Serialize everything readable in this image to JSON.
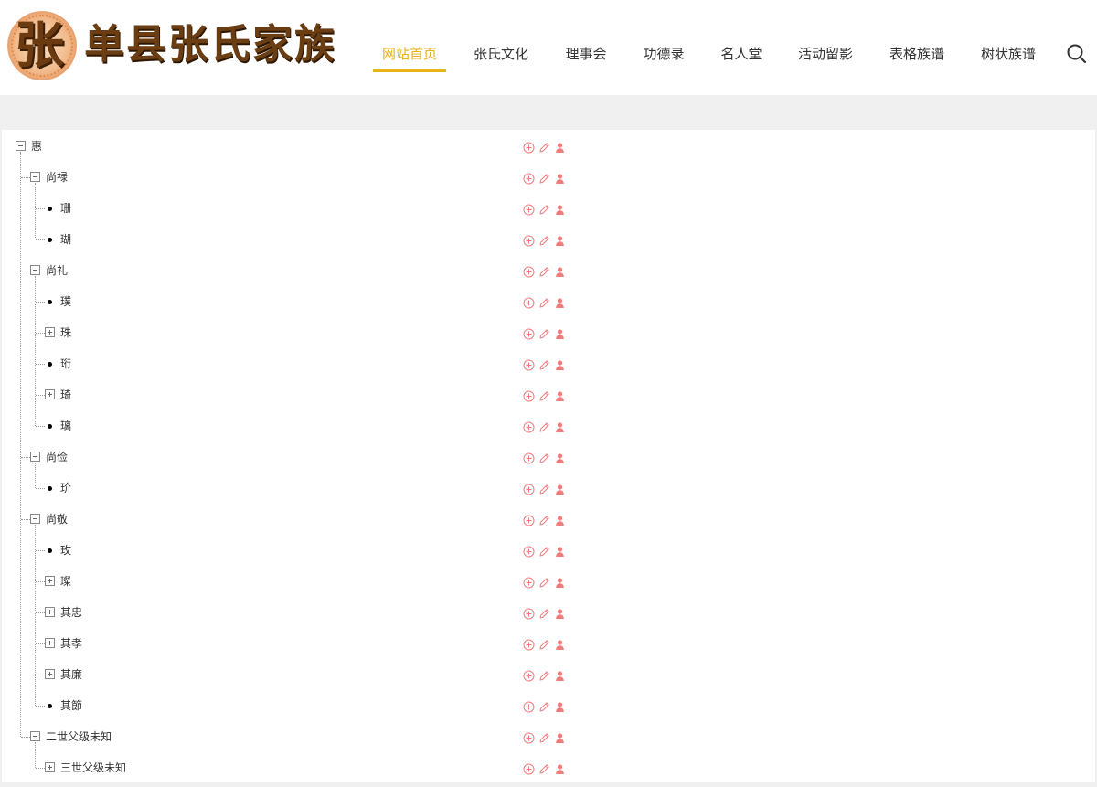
{
  "header": {
    "logo_char": "张",
    "logo_text": "单县张氏家族"
  },
  "nav": {
    "items": [
      {
        "label": "网站首页",
        "active": true
      },
      {
        "label": "张氏文化",
        "active": false
      },
      {
        "label": "理事会",
        "active": false
      },
      {
        "label": "功德录",
        "active": false
      },
      {
        "label": "名人堂",
        "active": false
      },
      {
        "label": "活动留影",
        "active": false
      },
      {
        "label": "表格族谱",
        "active": false
      },
      {
        "label": "树状族谱",
        "active": false
      }
    ],
    "search_icon": "search-icon"
  },
  "colors": {
    "accent": "#e8b21a",
    "action_icon": "#f07c7c",
    "logo_brown": "#6b3d12"
  },
  "tree": [
    {
      "label": "惠",
      "level": 0,
      "type": "expanded"
    },
    {
      "label": "尚禄",
      "level": 1,
      "type": "expanded"
    },
    {
      "label": "珊",
      "level": 2,
      "type": "leaf"
    },
    {
      "label": "瑚",
      "level": 2,
      "type": "leaf"
    },
    {
      "label": "尚礼",
      "level": 1,
      "type": "expanded"
    },
    {
      "label": "璞",
      "level": 2,
      "type": "leaf"
    },
    {
      "label": "珠",
      "level": 2,
      "type": "collapsed"
    },
    {
      "label": "珩",
      "level": 2,
      "type": "leaf"
    },
    {
      "label": "琦",
      "level": 2,
      "type": "collapsed"
    },
    {
      "label": "璃",
      "level": 2,
      "type": "leaf"
    },
    {
      "label": "尚俭",
      "level": 1,
      "type": "expanded"
    },
    {
      "label": "玠",
      "level": 2,
      "type": "leaf"
    },
    {
      "label": "尚敬",
      "level": 1,
      "type": "expanded"
    },
    {
      "label": "玫",
      "level": 2,
      "type": "leaf"
    },
    {
      "label": "璨",
      "level": 2,
      "type": "collapsed"
    },
    {
      "label": "其忠",
      "level": 2,
      "type": "collapsed"
    },
    {
      "label": "其孝",
      "level": 2,
      "type": "collapsed"
    },
    {
      "label": "其廉",
      "level": 2,
      "type": "collapsed"
    },
    {
      "label": "其節",
      "level": 2,
      "type": "leaf"
    },
    {
      "label": "二世父级未知",
      "level": 1,
      "type": "expanded"
    },
    {
      "label": "三世父级未知",
      "level": 2,
      "type": "collapsed"
    }
  ],
  "row_actions": [
    "add-circle-icon",
    "edit-pencil-icon",
    "user-icon"
  ]
}
